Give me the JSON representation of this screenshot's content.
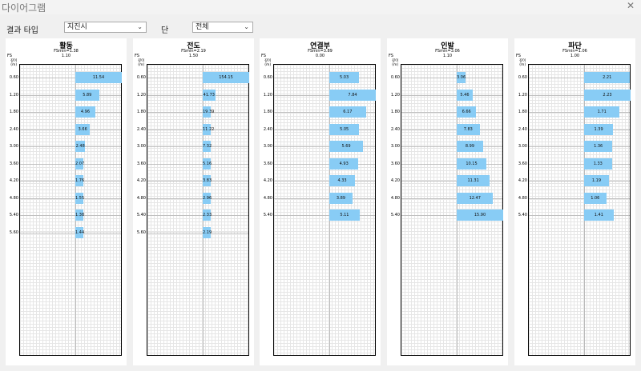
{
  "window": {
    "title": "다이어그램",
    "close_icon": "close-icon"
  },
  "toolbar": {
    "result_type_label": "결과 타입",
    "result_type_value": "지진시",
    "stage_label": "단",
    "stage_value": "전체"
  },
  "panels": [
    {
      "title": "활동",
      "fsmin": "FSmin=1.38",
      "fs_label": "FS",
      "fs_value": "1.10",
      "depth_head": "깊이\n(m)",
      "scale_max": 11.54,
      "rows": [
        {
          "depth": "0.60",
          "value": "11.54",
          "v": 11.54
        },
        {
          "depth": "1.20",
          "value": "5.89",
          "v": 5.89
        },
        {
          "depth": "1.80",
          "value": "4.96",
          "v": 4.96
        },
        {
          "depth": "2.40",
          "value": "3.66",
          "v": 3.66
        },
        {
          "depth": "3.00",
          "value": "2.48",
          "v": 2.48
        },
        {
          "depth": "3.60",
          "value": "2.07",
          "v": 2.07
        },
        {
          "depth": "4.20",
          "value": "1.76",
          "v": 1.76
        },
        {
          "depth": "4.80",
          "value": "1.55",
          "v": 1.55
        },
        {
          "depth": "5.40",
          "value": "1.38",
          "v": 1.38
        },
        {
          "depth": "5.60",
          "value": "1.44",
          "v": 1.44
        }
      ]
    },
    {
      "title": "전도",
      "fsmin": "FSmin=2.19",
      "fs_label": "FS",
      "fs_value": "1.50",
      "depth_head": "깊이\n(m)",
      "scale_max": 154.15,
      "rows": [
        {
          "depth": "0.60",
          "value": "154.15",
          "v": 154.15
        },
        {
          "depth": "1.20",
          "value": "41.73",
          "v": 41.73
        },
        {
          "depth": "1.80",
          "value": "19.39",
          "v": 19.39
        },
        {
          "depth": "2.40",
          "value": "11.22",
          "v": 11.22
        },
        {
          "depth": "3.00",
          "value": "7.32",
          "v": 7.32
        },
        {
          "depth": "3.60",
          "value": "5.16",
          "v": 5.16
        },
        {
          "depth": "4.20",
          "value": "3.83",
          "v": 3.83
        },
        {
          "depth": "4.80",
          "value": "2.96",
          "v": 2.96
        },
        {
          "depth": "5.40",
          "value": "2.33",
          "v": 2.33
        },
        {
          "depth": "5.60",
          "value": "2.19",
          "v": 2.19
        }
      ]
    },
    {
      "title": "연결부",
      "fsmin": "FSmin=3.89",
      "fs_label": "FS",
      "fs_value": "0.00",
      "depth_head": "깊이\n(m)",
      "scale_max": 7.84,
      "rows": [
        {
          "depth": "0.60",
          "value": "5.03",
          "v": 5.03
        },
        {
          "depth": "1.20",
          "value": "7.84",
          "v": 7.84
        },
        {
          "depth": "1.80",
          "value": "6.17",
          "v": 6.17
        },
        {
          "depth": "2.40",
          "value": "5.05",
          "v": 5.05
        },
        {
          "depth": "3.00",
          "value": "5.69",
          "v": 5.69
        },
        {
          "depth": "3.60",
          "value": "4.93",
          "v": 4.93
        },
        {
          "depth": "4.20",
          "value": "4.33",
          "v": 4.33
        },
        {
          "depth": "4.80",
          "value": "3.89",
          "v": 3.89
        },
        {
          "depth": "5.40",
          "value": "5.11",
          "v": 5.11
        }
      ]
    },
    {
      "title": "인발",
      "fsmin": "FSmin=3.06",
      "fs_label": "FS",
      "fs_value": "1.10",
      "depth_head": "깊이\n(m)",
      "scale_max": 15.9,
      "rows": [
        {
          "depth": "0.60",
          "value": "3.06",
          "v": 3.06
        },
        {
          "depth": "1.20",
          "value": "5.46",
          "v": 5.46
        },
        {
          "depth": "1.80",
          "value": "6.66",
          "v": 6.66
        },
        {
          "depth": "2.40",
          "value": "7.83",
          "v": 7.83
        },
        {
          "depth": "3.00",
          "value": "8.99",
          "v": 8.99
        },
        {
          "depth": "3.60",
          "value": "10.15",
          "v": 10.15
        },
        {
          "depth": "4.20",
          "value": "11.31",
          "v": 11.31
        },
        {
          "depth": "4.80",
          "value": "12.47",
          "v": 12.47
        },
        {
          "depth": "5.40",
          "value": "15.90",
          "v": 15.9
        }
      ]
    },
    {
      "title": "파단",
      "fsmin": "FSmin=1.06",
      "fs_label": "FS",
      "fs_value": "1.00",
      "depth_head": "깊이\n(m)",
      "scale_max": 2.23,
      "rows": [
        {
          "depth": "0.60",
          "value": "2.21",
          "v": 2.21
        },
        {
          "depth": "1.20",
          "value": "2.23",
          "v": 2.23
        },
        {
          "depth": "1.80",
          "value": "1.71",
          "v": 1.71
        },
        {
          "depth": "2.40",
          "value": "1.39",
          "v": 1.39
        },
        {
          "depth": "3.00",
          "value": "1.36",
          "v": 1.36
        },
        {
          "depth": "3.60",
          "value": "1.33",
          "v": 1.33
        },
        {
          "depth": "4.20",
          "value": "1.19",
          "v": 1.19
        },
        {
          "depth": "4.80",
          "value": "1.06",
          "v": 1.06
        },
        {
          "depth": "5.40",
          "value": "1.41",
          "v": 1.41
        }
      ]
    }
  ],
  "colors": {
    "bar": "#88ccf5",
    "grid": "#e6e6e6",
    "window_bg": "#f0f0f0"
  }
}
